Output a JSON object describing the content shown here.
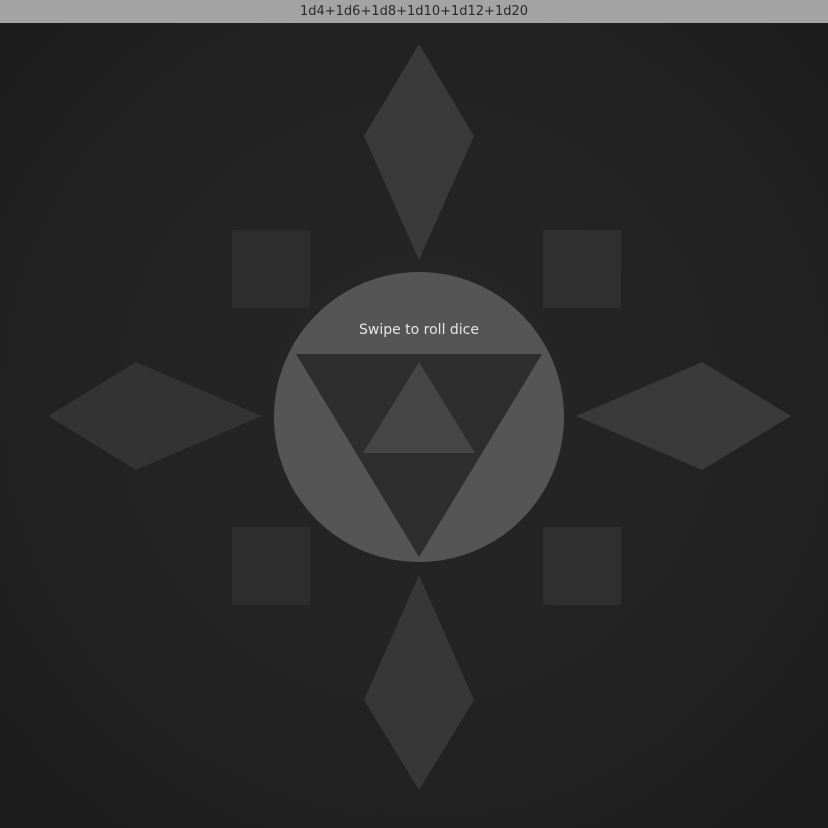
{
  "window": {
    "title": "1d4+1d6+1d8+1d10+1d12+1d20"
  },
  "main": {
    "prompt": "Swipe to roll dice"
  },
  "dice": [
    {
      "name": "d4",
      "icon": "triangle-die-icon"
    },
    {
      "name": "d6",
      "icon": "square-die-icon"
    },
    {
      "name": "d8",
      "icon": "diamond-die-icon"
    },
    {
      "name": "d10",
      "icon": "kite-die-icon"
    },
    {
      "name": "d12",
      "icon": "square-die-icon"
    },
    {
      "name": "d20",
      "icon": "circle-triangle-die-icon"
    }
  ],
  "colors": {
    "title_bar": "#a3a3a3",
    "background": "#1c1c1c",
    "shape_dark": "#2f2f2f",
    "shape_mid": "#3c3c3c",
    "center_circle": "#555555",
    "prompt_text": "#e6e6e6"
  }
}
